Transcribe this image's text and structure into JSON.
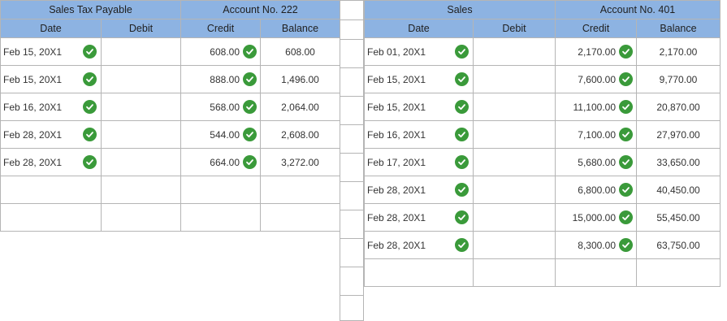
{
  "left_account": {
    "title": "Sales Tax Payable",
    "account_no": "Account No. 222",
    "headers": {
      "date": "Date",
      "debit": "Debit",
      "credit": "Credit",
      "balance": "Balance"
    },
    "rows": [
      {
        "date": "Feb 15, 20X1",
        "debit": "",
        "credit": "608.00",
        "balance": "608.00"
      },
      {
        "date": "Feb 15, 20X1",
        "debit": "",
        "credit": "888.00",
        "balance": "1,496.00"
      },
      {
        "date": "Feb 16, 20X1",
        "debit": "",
        "credit": "568.00",
        "balance": "2,064.00"
      },
      {
        "date": "Feb 28, 20X1",
        "debit": "",
        "credit": "544.00",
        "balance": "2,608.00"
      },
      {
        "date": "Feb 28, 20X1",
        "debit": "",
        "credit": "664.00",
        "balance": "3,272.00"
      },
      {
        "date": "",
        "debit": "",
        "credit": "",
        "balance": ""
      },
      {
        "date": "",
        "debit": "",
        "credit": "",
        "balance": ""
      }
    ]
  },
  "right_account": {
    "title": "Sales",
    "account_no": "Account No. 401",
    "headers": {
      "date": "Date",
      "debit": "Debit",
      "credit": "Credit",
      "balance": "Balance"
    },
    "rows": [
      {
        "date": "Feb 01, 20X1",
        "debit": "",
        "credit": "2,170.00",
        "balance": "2,170.00"
      },
      {
        "date": "Feb 15, 20X1",
        "debit": "",
        "credit": "7,600.00",
        "balance": "9,770.00"
      },
      {
        "date": "Feb 15, 20X1",
        "debit": "",
        "credit": "11,100.00",
        "balance": "20,870.00"
      },
      {
        "date": "Feb 16, 20X1",
        "debit": "",
        "credit": "7,100.00",
        "balance": "27,970.00"
      },
      {
        "date": "Feb 17, 20X1",
        "debit": "",
        "credit": "5,680.00",
        "balance": "33,650.00"
      },
      {
        "date": "Feb 28, 20X1",
        "debit": "",
        "credit": "6,800.00",
        "balance": "40,450.00"
      },
      {
        "date": "Feb 28, 20X1",
        "debit": "",
        "credit": "15,000.00",
        "balance": "55,450.00"
      },
      {
        "date": "Feb 28, 20X1",
        "debit": "",
        "credit": "8,300.00",
        "balance": "63,750.00"
      },
      {
        "date": "",
        "debit": "",
        "credit": "",
        "balance": ""
      }
    ]
  },
  "icons": {
    "correct": "check-circle-icon"
  },
  "colors": {
    "header_bg": "#8db3e2",
    "check_green": "#3a9a3a",
    "grid": "#b5b5b5"
  }
}
